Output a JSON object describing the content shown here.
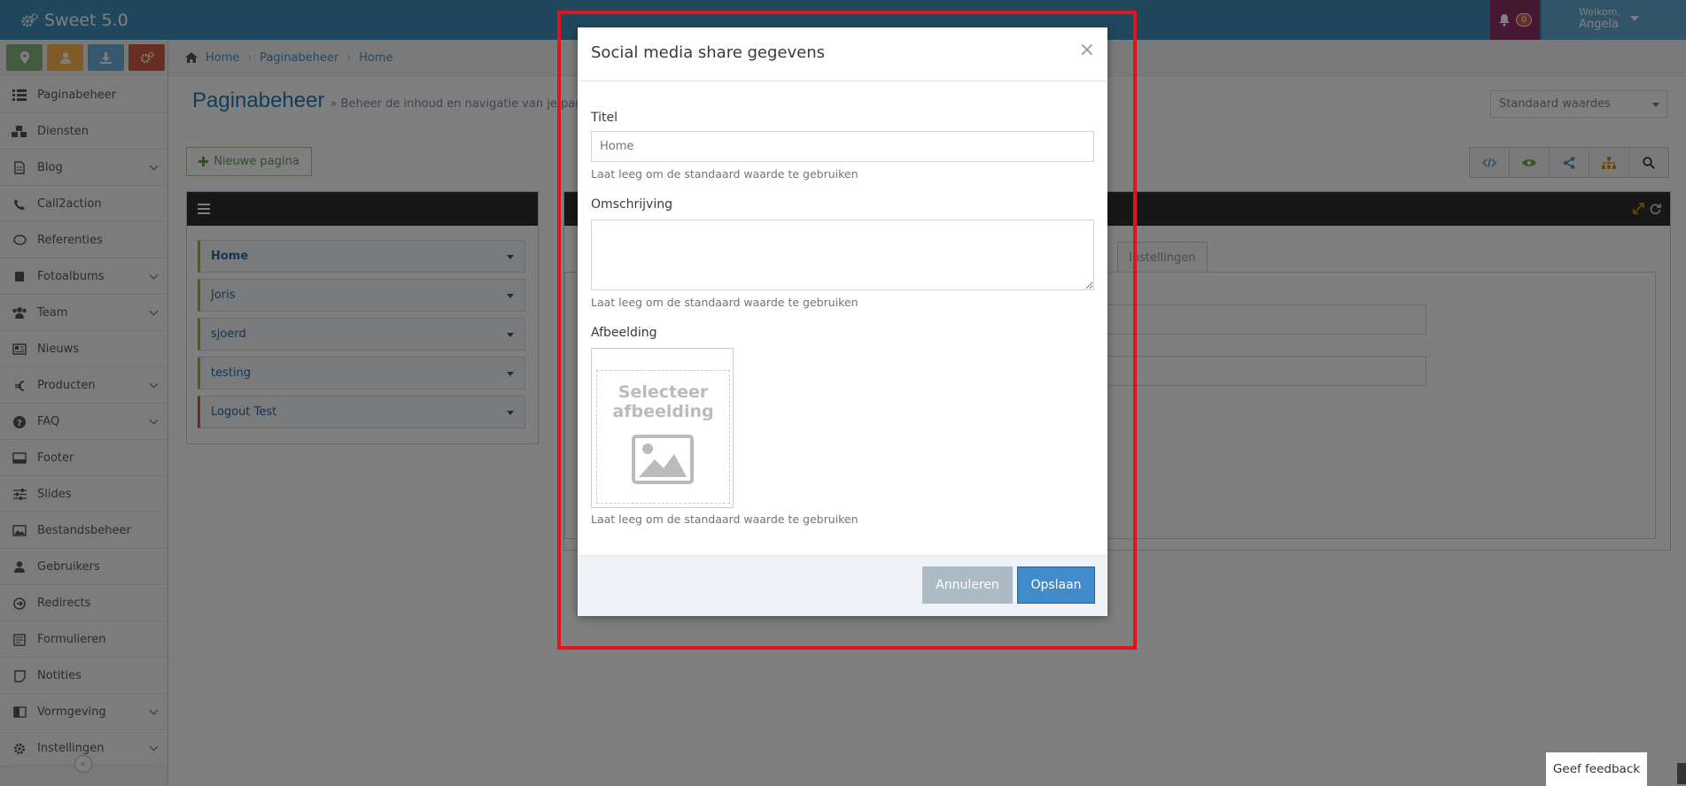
{
  "app": {
    "title": "Sweet 5.0",
    "notification_count": "0",
    "welcome": "Welkom,",
    "user_name": "Angela"
  },
  "sidebar": {
    "items": [
      {
        "label": "Paginabeheer",
        "icon": "list-icon",
        "has_submenu": false
      },
      {
        "label": "Diensten",
        "icon": "cubes-icon",
        "has_submenu": false
      },
      {
        "label": "Blog",
        "icon": "file-icon",
        "has_submenu": true
      },
      {
        "label": "Call2action",
        "icon": "phone-icon",
        "has_submenu": false
      },
      {
        "label": "Referenties",
        "icon": "comment-icon",
        "has_submenu": false
      },
      {
        "label": "Fotoalbums",
        "icon": "book-icon",
        "has_submenu": true
      },
      {
        "label": "Team",
        "icon": "users-icon",
        "has_submenu": true
      },
      {
        "label": "Nieuws",
        "icon": "newspaper-icon",
        "has_submenu": false
      },
      {
        "label": "Producten",
        "icon": "euro-icon",
        "has_submenu": true
      },
      {
        "label": "FAQ",
        "icon": "question-icon",
        "has_submenu": true
      },
      {
        "label": "Footer",
        "icon": "footer-icon",
        "has_submenu": false
      },
      {
        "label": "Slides",
        "icon": "sliders-icon",
        "has_submenu": false
      },
      {
        "label": "Bestandsbeheer",
        "icon": "image-icon",
        "has_submenu": false
      },
      {
        "label": "Gebruikers",
        "icon": "user-icon",
        "has_submenu": false
      },
      {
        "label": "Redirects",
        "icon": "arrow-circle-icon",
        "has_submenu": false
      },
      {
        "label": "Formulieren",
        "icon": "form-icon",
        "has_submenu": false
      },
      {
        "label": "Notities",
        "icon": "note-icon",
        "has_submenu": false
      },
      {
        "label": "Vormgeving",
        "icon": "layout-icon",
        "has_submenu": true
      },
      {
        "label": "Instellingen",
        "icon": "cog-icon",
        "has_submenu": true
      }
    ]
  },
  "breadcrumb": [
    "Home",
    "Paginabeheer",
    "Home"
  ],
  "page": {
    "title": "Paginabeheer",
    "subtitle": "» Beheer de inhoud en navigatie van je pag",
    "select_value": "Standaard waardes",
    "new_page_label": "Nieuwe pagina"
  },
  "pages_list": [
    {
      "name": "Home",
      "accent": "#9abc32",
      "bold": true
    },
    {
      "name": "Joris",
      "accent": "#9abc32",
      "bold": false
    },
    {
      "name": "sjoerd",
      "accent": "#9abc32",
      "bold": false
    },
    {
      "name": "testing",
      "accent": "#9abc32",
      "bold": false
    },
    {
      "name": "Logout Test",
      "accent": "#d15b47",
      "bold": false
    }
  ],
  "right_panel": {
    "tab_label": "Instellingen"
  },
  "modal": {
    "title": "Social media share gegevens",
    "close": "×",
    "title_label": "Titel",
    "title_placeholder": "Home",
    "help": "Laat leeg om de standaard waarde te gebruiken",
    "description_label": "Omschrijving",
    "description_value": "",
    "image_label": "Afbeelding",
    "image_picker_text_1": "Selecteer",
    "image_picker_text_2": "afbeelding",
    "cancel": "Annuleren",
    "save": "Opslaan"
  },
  "feedback": "Geef feedback",
  "colors": {
    "topbar": "#438eb9",
    "primary": "#428bca",
    "highlight": "#e0141b"
  }
}
